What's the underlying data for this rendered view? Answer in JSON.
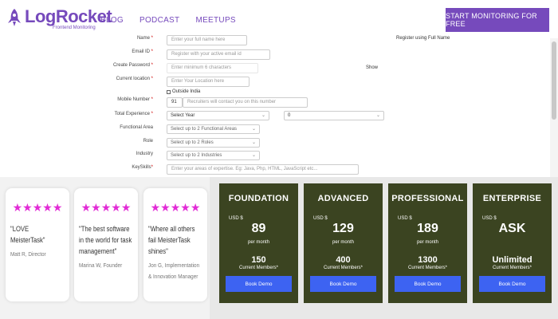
{
  "header": {
    "logo_name": "LogRocket",
    "logo_tagline": "Frontend Monitoring",
    "nav": [
      "BLOG",
      "PODCAST",
      "MEETUPS"
    ],
    "cta_label": "START MONITORING FOR FREE",
    "brand_color": "#764abc"
  },
  "form": {
    "name": {
      "label": "Name",
      "placeholder": "Enter your full name here"
    },
    "register_hint": "Register using Full Name",
    "email": {
      "label": "Email ID",
      "placeholder": "Register with your active email id"
    },
    "password": {
      "label": "Create Password",
      "placeholder": "Enter minimum 6 characters",
      "show": "Show"
    },
    "location": {
      "label": "Current location",
      "placeholder": "Enter Your Location here"
    },
    "outside_india": "Outside India",
    "mobile": {
      "label": "Mobile Number",
      "code": "91",
      "placeholder": "Recruiters will contact you on this number"
    },
    "experience": {
      "label": "Total Experience",
      "year": "Select Year",
      "month": "0"
    },
    "functional_area": {
      "label": "Functional Area",
      "value": "Select up to 2 Functional Areas"
    },
    "role": {
      "label": "Role",
      "value": "Select up to 2 Roles"
    },
    "industry": {
      "label": "Industry",
      "value": "Select up to 2 Industries"
    },
    "keyskills": {
      "label": "KeySkills",
      "placeholder": "Enter your areas of expertise. Eg: Java, Php, HTML, JavaScript etc..."
    },
    "req": "*"
  },
  "reviews": [
    {
      "stars": "★★★★★",
      "quote": "\"LOVE MeisterTask\"",
      "author": "Matt R, Director"
    },
    {
      "stars": "★★★★★",
      "quote": "\"The best software in the world for task management\"",
      "author": "Marina W, Founder"
    },
    {
      "stars": "★★★★★",
      "quote": "\"Where all others fail MeisterTask shines\"",
      "author": "Jon G, Implementation & Innovation Manager"
    }
  ],
  "plans": [
    {
      "name": "FOUNDATION",
      "currency": "USD $",
      "price": "89",
      "per": "per month",
      "count": "150",
      "members": "Current Members*",
      "button": "Book Demo"
    },
    {
      "name": "ADVANCED",
      "currency": "USD $",
      "price": "129",
      "per": "per month",
      "count": "400",
      "members": "Current Members*",
      "button": "Book Demo"
    },
    {
      "name": "PROFESSIONAL",
      "currency": "USD $",
      "price": "189",
      "per": "per month",
      "count": "1300",
      "members": "Current Members*",
      "button": "Book Demo"
    },
    {
      "name": "ENTERPRISE",
      "currency": "USD $",
      "price": "ASK",
      "per": "",
      "count": "Unlimited",
      "members": "Current Members*",
      "button": "Book Demo"
    }
  ],
  "colors": {
    "plan_bg": "#3b4421",
    "button": "#3d63f2",
    "stars": "#e22bd6"
  }
}
